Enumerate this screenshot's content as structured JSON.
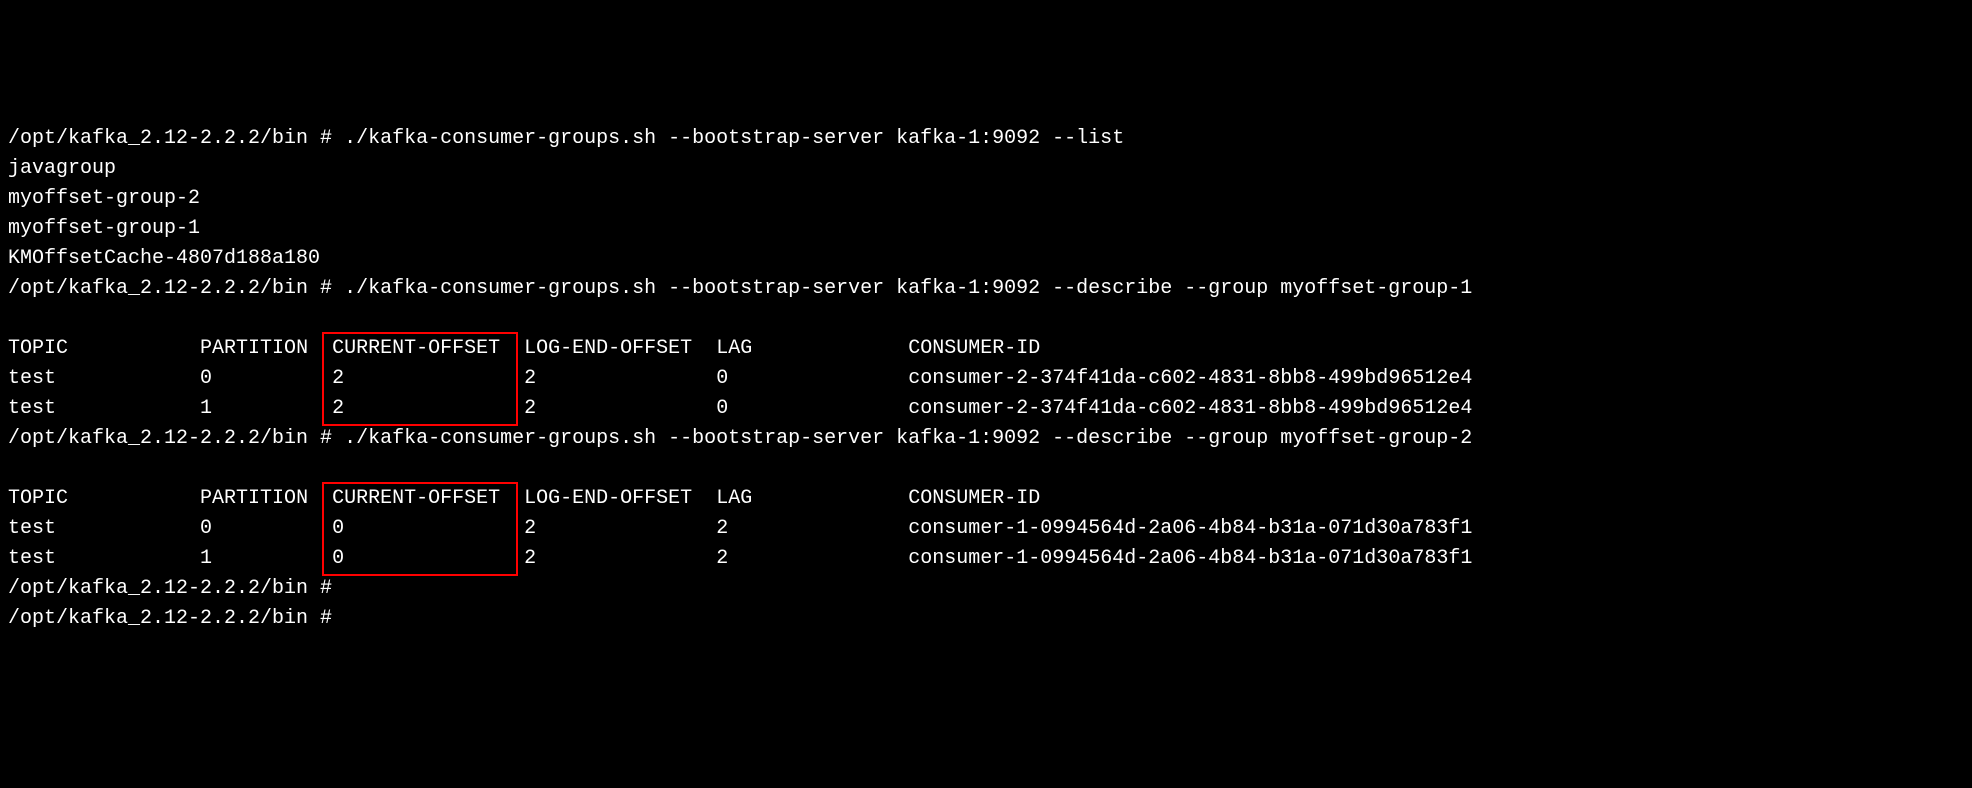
{
  "prompt": "/opt/kafka_2.12-2.2.2/bin # ",
  "cmd_list": "./kafka-consumer-groups.sh --bootstrap-server kafka-1:9092 --list",
  "groups": [
    "javagroup",
    "myoffset-group-2",
    "myoffset-group-1",
    "KMOffsetCache-4807d188a180"
  ],
  "cmd_desc1": "./kafka-consumer-groups.sh --bootstrap-server kafka-1:9092 --describe --group myoffset-group-1",
  "cmd_desc2": "./kafka-consumer-groups.sh --bootstrap-server kafka-1:9092 --describe --group myoffset-group-2",
  "headers": {
    "topic": "TOPIC",
    "partition": "PARTITION",
    "current_offset": "CURRENT-OFFSET",
    "log_end_offset": "LOG-END-OFFSET",
    "lag": "LAG",
    "consumer_id": "CONSUMER-ID"
  },
  "table1": [
    {
      "topic": "test",
      "partition": "0",
      "current": "2",
      "logend": "2",
      "lag": "0",
      "consumer": "consumer-2-374f41da-c602-4831-8bb8-499bd96512e4"
    },
    {
      "topic": "test",
      "partition": "1",
      "current": "2",
      "logend": "2",
      "lag": "0",
      "consumer": "consumer-2-374f41da-c602-4831-8bb8-499bd96512e4"
    }
  ],
  "table2": [
    {
      "topic": "test",
      "partition": "0",
      "current": "0",
      "logend": "2",
      "lag": "2",
      "consumer": "consumer-1-0994564d-2a06-4b84-b31a-071d30a783f1"
    },
    {
      "topic": "test",
      "partition": "1",
      "current": "0",
      "logend": "2",
      "lag": "2",
      "consumer": "consumer-1-0994564d-2a06-4b84-b31a-071d30a783f1"
    }
  ]
}
